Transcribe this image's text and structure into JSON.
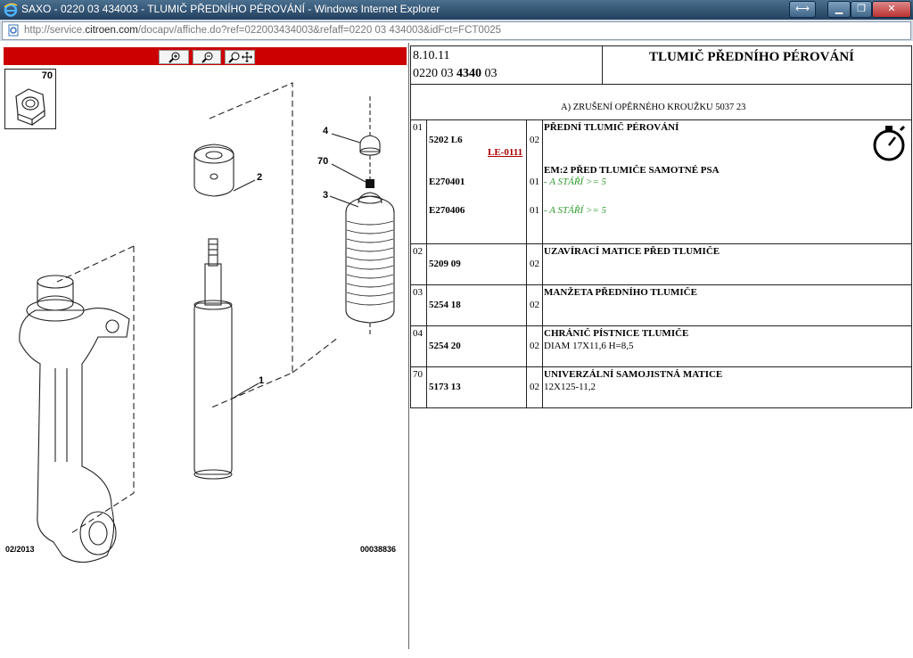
{
  "window": {
    "title": "SAXO - 0220 03 434003 - TLUMIČ PŘEDNÍHO PÉROVÁNÍ - Windows Internet Explorer",
    "url_prefix": "http://service.",
    "url_domain": "citroen.com",
    "url_suffix": "/docapv/affiche.do?ref=022003434003&refaff=0220 03 434003&idFct=FCT0025"
  },
  "diagram": {
    "inset_label": "70",
    "callouts": [
      "4",
      "70",
      "2",
      "3",
      "1"
    ],
    "date_code": "02/2013",
    "image_code": "00038836"
  },
  "header": {
    "date": "8.10.11",
    "ref_prefix": "0220 03 ",
    "ref_bold": "4340",
    "ref_suffix": " 03",
    "title": "TLUMIČ PŘEDNÍHO PÉROVÁNÍ",
    "note": "A) ZRUŠENÍ OPĚRNÉHO KROUŽKU 5037 23"
  },
  "parts": [
    {
      "index": "01",
      "lines": [
        {
          "ref": "5202 L6",
          "qty": "02",
          "desc": "PŘEDNÍ TLUMIČ PÉROVÁNÍ",
          "desc_style": "bold"
        },
        {
          "link": "LE-0111"
        },
        {
          "ref": "E270401",
          "qty": "01",
          "desc": "EM:2 PŘED TLUMIČE SAMOTNÉ PSA",
          "desc_style": "bold",
          "note": "- A STÁŘÍ >= 5"
        },
        {
          "ref": "E270406",
          "qty": "01",
          "note": "- A STÁŘÍ >= 5"
        }
      ]
    },
    {
      "index": "02",
      "ref": "5209 09",
      "qty": "02",
      "desc": "UZAVÍRACÍ MATICE PŘED TLUMIČE",
      "extra": ""
    },
    {
      "index": "03",
      "ref": "5254 18",
      "qty": "02",
      "desc": "MANŽETA PŘEDNÍHO TLUMIČE",
      "extra": ""
    },
    {
      "index": "04",
      "ref": "5254 20",
      "qty": "02",
      "desc": "CHRÁNIČ PÍSTNICE TLUMIČE",
      "extra": "DIAM 17X11,6 H=8,5"
    },
    {
      "index": "70",
      "ref": "5173 13",
      "qty": "02",
      "desc": "UNIVERZÁLNÍ SAMOJISTNÁ MATICE",
      "extra": "12X125-11,2"
    }
  ],
  "icons": {
    "browser": "ie-logo-icon",
    "page": "page-icon",
    "zoom_in": "zoom-in-icon",
    "zoom_out": "zoom-out-icon",
    "zoom_pan": "zoom-pan-icon",
    "timer": "stopwatch-icon"
  },
  "colors": {
    "toolbar": "#cc0000",
    "link": "#aa0000",
    "note": "#2a9a2a"
  }
}
